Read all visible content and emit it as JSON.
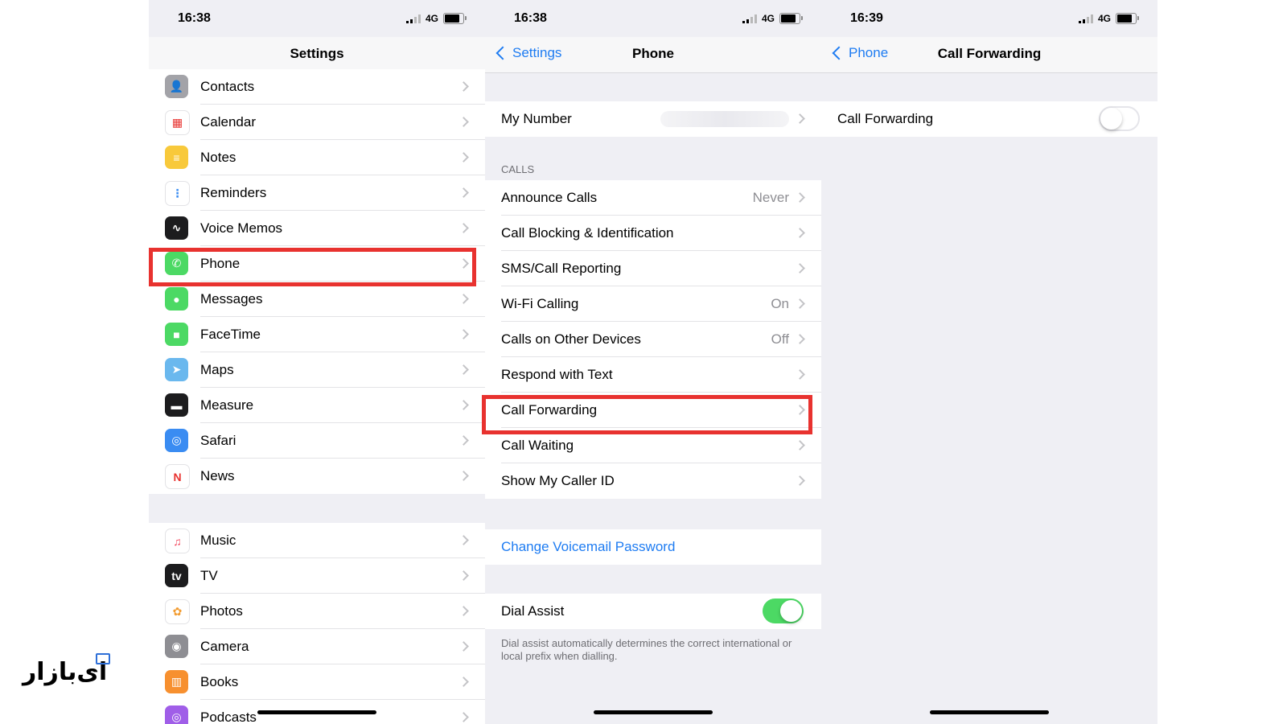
{
  "status": {
    "p1_time": "16:38",
    "p2_time": "16:38",
    "p3_time": "16:39",
    "network": "4G"
  },
  "settings_screen": {
    "title": "Settings",
    "group1": [
      {
        "label": "Contacts",
        "icon": "contacts-icon",
        "color": "#a3a3a8"
      },
      {
        "label": "Calendar",
        "icon": "calendar-icon",
        "color": "#ffffff"
      },
      {
        "label": "Notes",
        "icon": "notes-icon",
        "color": "#f8c93b"
      },
      {
        "label": "Reminders",
        "icon": "reminders-icon",
        "color": "#ffffff"
      },
      {
        "label": "Voice Memos",
        "icon": "voice-memos-icon",
        "color": "#1c1c1e"
      },
      {
        "label": "Phone",
        "icon": "phone-icon",
        "color": "#4cd964"
      },
      {
        "label": "Messages",
        "icon": "messages-icon",
        "color": "#4cd964"
      },
      {
        "label": "FaceTime",
        "icon": "facetime-icon",
        "color": "#4cd964"
      },
      {
        "label": "Maps",
        "icon": "maps-icon",
        "color": "#6ab8ee"
      },
      {
        "label": "Measure",
        "icon": "measure-icon",
        "color": "#1c1c1e"
      },
      {
        "label": "Safari",
        "icon": "safari-icon",
        "color": "#3a8cf2"
      },
      {
        "label": "News",
        "icon": "news-icon",
        "color": "#ffffff"
      }
    ],
    "group2": [
      {
        "label": "Music",
        "icon": "music-icon",
        "color": "#ffffff"
      },
      {
        "label": "TV",
        "icon": "tv-icon",
        "color": "#1c1c1e"
      },
      {
        "label": "Photos",
        "icon": "photos-icon",
        "color": "#ffffff"
      },
      {
        "label": "Camera",
        "icon": "camera-icon",
        "color": "#8e8e93"
      },
      {
        "label": "Books",
        "icon": "books-icon",
        "color": "#f7902f"
      },
      {
        "label": "Podcasts",
        "icon": "podcasts-icon",
        "color": "#a05ee8"
      }
    ]
  },
  "phone_screen": {
    "back_label": "Settings",
    "title": "Phone",
    "my_number_label": "My Number",
    "calls_header": "CALLS",
    "calls": [
      {
        "label": "Announce Calls",
        "value": "Never"
      },
      {
        "label": "Call Blocking & Identification",
        "value": ""
      },
      {
        "label": "SMS/Call Reporting",
        "value": ""
      },
      {
        "label": "Wi-Fi Calling",
        "value": "On"
      },
      {
        "label": "Calls on Other Devices",
        "value": "Off"
      },
      {
        "label": "Respond with Text",
        "value": ""
      },
      {
        "label": "Call Forwarding",
        "value": ""
      },
      {
        "label": "Call Waiting",
        "value": ""
      },
      {
        "label": "Show My Caller ID",
        "value": ""
      }
    ],
    "change_voicemail_label": "Change Voicemail Password",
    "dial_assist_label": "Dial Assist",
    "dial_assist_on": true,
    "dial_assist_note": "Dial assist automatically determines the correct international or local prefix when dialling."
  },
  "forwarding_screen": {
    "back_label": "Phone",
    "title": "Call Forwarding",
    "row_label": "Call Forwarding",
    "enabled": false
  },
  "watermark": {
    "text": "ای‌بازار"
  },
  "colors": {
    "accent": "#1e7cf2",
    "highlight": "#e8322f",
    "toggle_on": "#4cd964"
  }
}
